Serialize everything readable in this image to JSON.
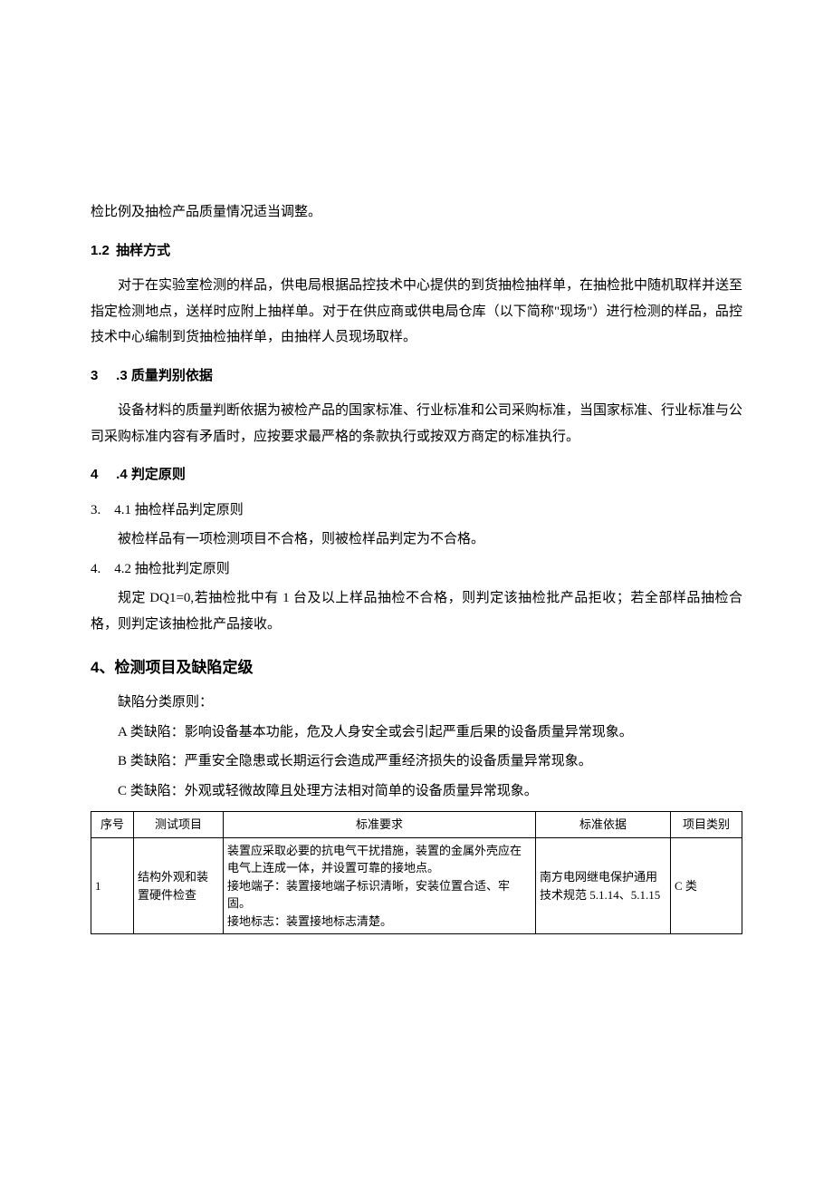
{
  "p_intro": "检比例及抽检产品质量情况适当调整。",
  "h12_num": "1.2",
  "h12_title": "抽样方式",
  "p12": "对于在实验室检测的样品，供电局根据品控技术中心提供的到货抽检抽样单，在抽检批中随机取样并送至指定检测地点，送样时应附上抽样单。对于在供应商或供电局仓库（以下简称\"现场\"）进行检测的样品，品控技术中心编制到货抽检抽样单，由抽样人员现场取样。",
  "h33_num": "3",
  "h33_title": ".3 质量判别依据",
  "p33": "设备材料的质量判断依据为被检产品的国家标准、行业标准和公司采购标准，当国家标准、行业标准与公司采购标准内容有矛盾时，应按要求最严格的条款执行或按双方商定的标准执行。",
  "h44_num": "4",
  "h44_title": ".4 判定原则",
  "h341": "3.　4.1 抽检样品判定原则",
  "p341": "被检样品有一项检测项目不合格，则被检样品判定为不合格。",
  "h442": "4.　4.2 抽检批判定原则",
  "p442": "规定 DQ1=0,若抽检批中有 1 台及以上样品抽检不合格，则判定该抽检批产品拒收；若全部样品抽检合格，则判定该抽检批产品接收。",
  "h4big": "4、检测项目及缺陷定级",
  "p_defect_intro": "缺陷分类原则：",
  "p_defect_a": "A 类缺陷：影响设备基本功能，危及人身安全或会引起严重后果的设备质量异常现象。",
  "p_defect_b": "B 类缺陷：严重安全隐患或长期运行会造成严重经济损失的设备质量异常现象。",
  "p_defect_c": "C 类缺陷：外观或轻微故障且处理方法相对简单的设备质量异常现象。",
  "table": {
    "headers": {
      "seq": "序号",
      "item": "测试项目",
      "req": "标准要求",
      "basis": "标准依据",
      "cat": "项目类别"
    },
    "rows": [
      {
        "seq": "1",
        "item": "结构外观和装置硬件检查",
        "req": "装置应采取必要的抗电气干扰措施，装置的金属外壳应在电气上连成一体，并设置可靠的接地点。\n接地端子：装置接地端子标识清晰，安装位置合适、牢固。\n接地标志：装置接地标志清楚。",
        "basis": "南方电网继电保护通用技术规范 5.1.14、5.1.15",
        "cat": "C 类"
      }
    ]
  }
}
